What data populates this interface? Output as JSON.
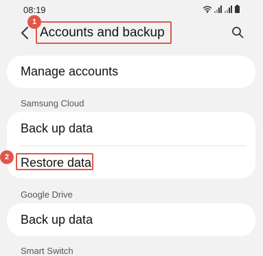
{
  "status_bar": {
    "time": "08:19",
    "icons": [
      "wifi-icon",
      "signal-icon",
      "signal-icon",
      "battery-icon"
    ]
  },
  "header": {
    "title": "Accounts and backup",
    "back_icon": "back-arrow-icon",
    "search_icon": "search-icon"
  },
  "manage_accounts": {
    "label": "Manage accounts"
  },
  "samsung_cloud": {
    "header": "Samsung Cloud",
    "items": [
      {
        "label": "Back up data"
      },
      {
        "label": "Restore data"
      }
    ]
  },
  "google_drive": {
    "header": "Google Drive",
    "items": [
      {
        "label": "Back up data"
      }
    ]
  },
  "smart_switch": {
    "header": "Smart Switch"
  },
  "annotations": {
    "step1": "1",
    "step2": "2",
    "color": "#e0564a"
  }
}
